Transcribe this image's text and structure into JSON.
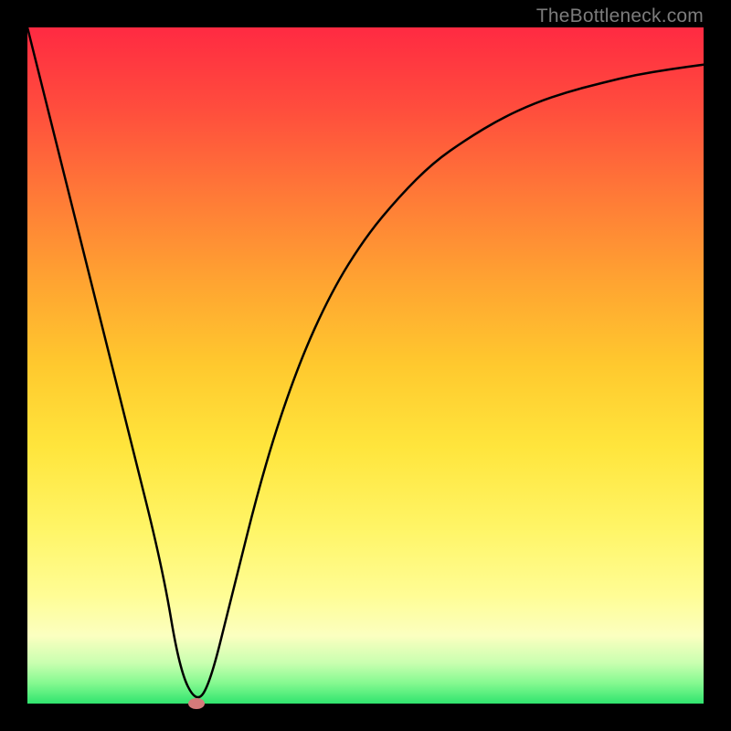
{
  "watermark": "TheBottleneck.com",
  "chart_data": {
    "type": "line",
    "title": "",
    "xlabel": "",
    "ylabel": "",
    "xlim": [
      0,
      100
    ],
    "ylim": [
      0,
      100
    ],
    "grid": false,
    "series": [
      {
        "name": "bottleneck-curve",
        "x": [
          0,
          5,
          10,
          15,
          20,
          22.5,
          25,
          27,
          30,
          35,
          40,
          45,
          50,
          55,
          60,
          65,
          70,
          75,
          80,
          85,
          90,
          95,
          100
        ],
        "values": [
          100,
          80,
          60,
          40,
          20,
          5,
          0,
          3,
          15,
          35,
          50,
          61,
          69,
          75,
          80,
          83.5,
          86.5,
          88.8,
          90.5,
          91.8,
          93,
          93.8,
          94.5
        ]
      }
    ],
    "marker": {
      "x": 25,
      "y": 0,
      "name": "optimal-point"
    }
  }
}
